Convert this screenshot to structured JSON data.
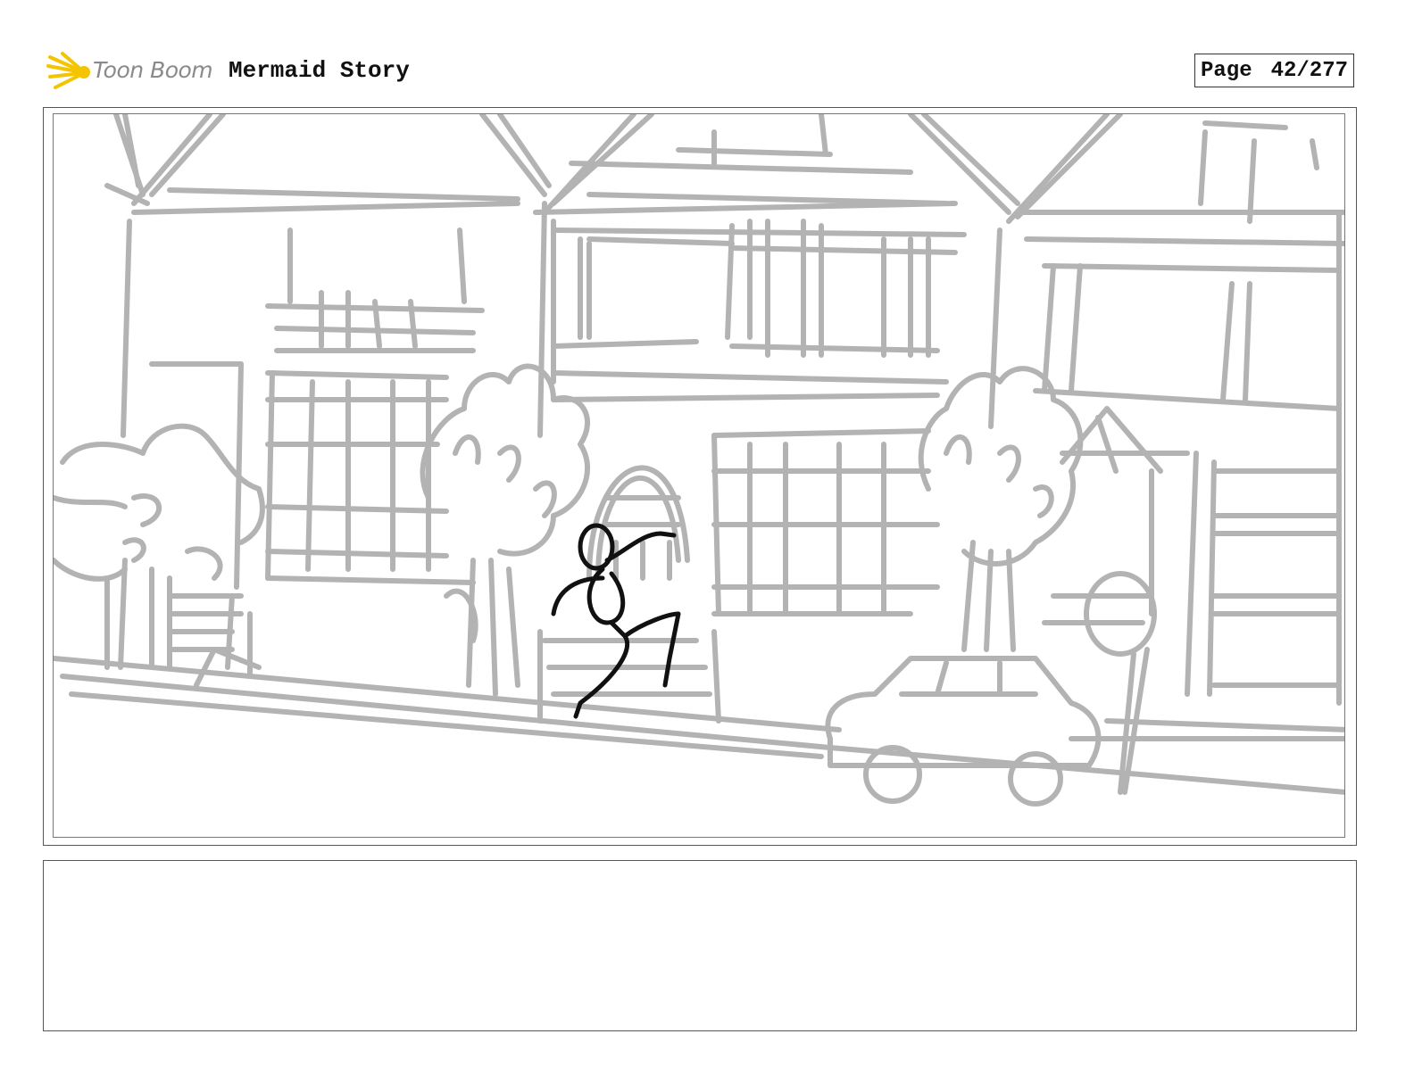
{
  "header": {
    "logo_text": "Toon Boom",
    "project_title": "Mermaid Story",
    "page_label": "Page",
    "page_number": "42/277"
  },
  "colors": {
    "sketch": "#b3b3b3",
    "figure": "#111111",
    "logo_accent": "#f5c400"
  },
  "notes": {
    "text": ""
  }
}
